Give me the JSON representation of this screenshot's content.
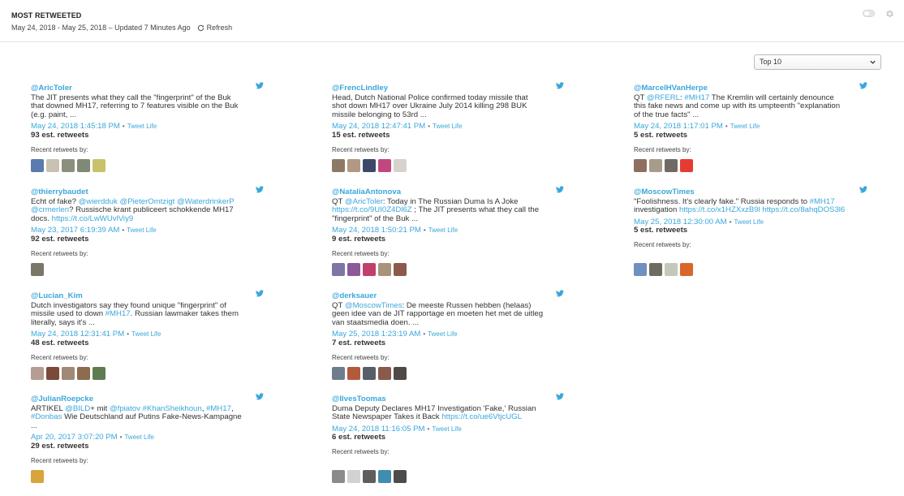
{
  "header": {
    "title": "MOST RETWEETED",
    "subtitle": "May 24, 2018 - May 25, 2018 – Updated 7 Minutes Ago",
    "refresh_label": "Refresh"
  },
  "filter": {
    "selected": "Top 10"
  },
  "labels": {
    "recent": "Recent retweets by:",
    "tweet_life": "Tweet Life",
    "separator": "•"
  },
  "tweets": [
    {
      "handle": "@AricToler",
      "parts": [
        {
          "t": "The JIT presents what they call the \"fingerprint\" of the Buk that downed MH17, referring to 7 features visible on the Buk (e.g. paint, ..."
        }
      ],
      "date": "May 24, 2018 1:45:18 PM",
      "count": "93 est. retweets",
      "avatars": [
        "#5a7bb0",
        "#c9c2b0",
        "#8a8f7e",
        "#7e8a76",
        "#c8c26a"
      ]
    },
    {
      "handle": "@FrencLindley",
      "parts": [
        {
          "t": "Head, Dutch National Police confirmed today missile that shot down MH17 over Ukraine July 2014 killing 298 BUK missile belonging to 53rd ..."
        }
      ],
      "date": "May 24, 2018 12:47:41 PM",
      "count": "15 est. retweets",
      "avatars": [
        "#8c7a66",
        "#b39883",
        "#3c4867",
        "#c2477f",
        "#d7d2cc"
      ]
    },
    {
      "handle": "@MarcelHVanHerpe",
      "parts": [
        {
          "t": "QT "
        },
        {
          "t": "@RFERL",
          "l": true
        },
        {
          "t": ": "
        },
        {
          "t": "#MH17",
          "l": true
        },
        {
          "t": " The Kremlin will certainly denounce this fake news and come up with its umpteenth \"explanation of the true facts\" ..."
        }
      ],
      "date": "May 24, 2018 1:17:01 PM",
      "count": "5 est. retweets",
      "avatars": [
        "#8d7060",
        "#a79b8c",
        "#6f6a63",
        "#e63b33"
      ]
    },
    {
      "handle": "@thierrybaudet",
      "parts": [
        {
          "t": "Echt of fake? "
        },
        {
          "t": "@wierdduk",
          "l": true
        },
        {
          "t": " "
        },
        {
          "t": "@PieterOmtzigt",
          "l": true
        },
        {
          "t": " "
        },
        {
          "t": "@WaterdrinkerP",
          "l": true
        },
        {
          "t": " "
        },
        {
          "t": "@crmerlen",
          "l": true
        },
        {
          "t": "? Russische krant publiceert schokkende MH17 docs. "
        },
        {
          "t": "https://t.co/LwWUvlViy9",
          "l": true
        }
      ],
      "date": "May 23, 2017 6:19:39 AM",
      "count": "92 est. retweets",
      "avatars": [
        "#7a7768"
      ]
    },
    {
      "handle": "@NataliaAntonova",
      "parts": [
        {
          "t": "QT "
        },
        {
          "t": "@AricToler",
          "l": true
        },
        {
          "t": ": Today in The Russian Duma Is A Joke "
        },
        {
          "t": "https://t.co/9UI0Z4Dl6Z",
          "l": true
        },
        {
          "t": " ; The JIT presents what they call the \"fingerprint\" of the Buk ..."
        }
      ],
      "date": "May 24, 2018 1:50:21 PM",
      "count": "9 est. retweets",
      "avatars": [
        "#7e74a5",
        "#8c5a9a",
        "#c23f6c",
        "#a8947a",
        "#8c5a4d"
      ]
    },
    {
      "handle": "@MoscowTimes",
      "parts": [
        {
          "t": "\"Foolishness. It's clearly fake.\" Russia responds to "
        },
        {
          "t": "#MH17",
          "l": true
        },
        {
          "t": " investigation "
        },
        {
          "t": "https://t.co/x1HZXxzB9l",
          "l": true
        },
        {
          "t": " "
        },
        {
          "t": "https://t.co/8ahqDOS3l6",
          "l": true
        }
      ],
      "date": "May 25, 2018 12:30:00 AM",
      "count": "5 est. retweets",
      "avatars": [
        "#7090bf",
        "#6e6b60",
        "#c4c8b8",
        "#d9662a"
      ]
    },
    {
      "handle": "@Lucian_Kim",
      "parts": [
        {
          "t": "Dutch investigators say they found unique \"fingerprint\" of missile used to down "
        },
        {
          "t": "#MH17",
          "l": true
        },
        {
          "t": ". Russian lawmaker takes them literally, says it's ..."
        }
      ],
      "date": "May 24, 2018 12:31:41 PM",
      "count": "48 est. retweets",
      "avatars": [
        "#b59d93",
        "#7b4a3a",
        "#a08977",
        "#8c6b4f",
        "#5f7b52"
      ]
    },
    {
      "handle": "@derksauer",
      "parts": [
        {
          "t": "QT "
        },
        {
          "t": "@MoscowTimes",
          "l": true
        },
        {
          "t": ": De meeste Russen hebben (helaas) geen idee van de JIT rapportage en moeten het met de uitleg van staatsmedia doen. ..."
        }
      ],
      "date": "May 25, 2018 1:23:19 AM",
      "count": "7 est. retweets",
      "avatars": [
        "#6e7d8e",
        "#b45a3c",
        "#585e69",
        "#8a5a4b",
        "#4f4a47"
      ]
    },
    {
      "handle": "@JulianRoepcke",
      "parts": [
        {
          "t": "ARTIKEL "
        },
        {
          "t": "@BILD",
          "l": true
        },
        {
          "t": "+ mit "
        },
        {
          "t": "@fpiatov",
          "l": true
        },
        {
          "t": " "
        },
        {
          "t": "#KhanSheikhoun",
          "l": true
        },
        {
          "t": ", "
        },
        {
          "t": "#MH17",
          "l": true
        },
        {
          "t": ", "
        },
        {
          "t": "#Donbas",
          "l": true
        },
        {
          "t": " Wie Deutschland auf Putins Fake-News-Kampagne ..."
        }
      ],
      "date": "Apr 20, 2017 3:07:20 PM",
      "count": "29 est. retweets",
      "avatars": [
        "#d9a43b"
      ]
    },
    {
      "handle": "@IlvesToomas",
      "parts": [
        {
          "t": "Duma Deputy Declares MH17 Investigation 'Fake,' Russian State Newspaper Takes it Back "
        },
        {
          "t": "https://t.co/ue6VtjcUGL",
          "l": true
        }
      ],
      "date": "May 24, 2018 11:16:05 PM",
      "count": "6 est. retweets",
      "avatars": [
        "#8b8b8b",
        "#d2d2d2",
        "#5e5e5e",
        "#3f8db0",
        "#4e4c4a"
      ]
    }
  ]
}
